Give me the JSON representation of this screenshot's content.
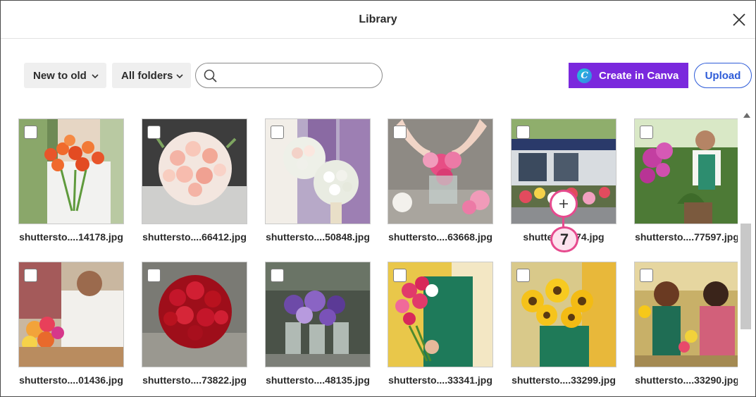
{
  "dialog": {
    "title": "Library"
  },
  "toolbar": {
    "sort_label": "New to old",
    "folder_label": "All folders",
    "search_value": "",
    "search_placeholder": "",
    "create_label": "Create in Canva",
    "create_logo_letter": "C",
    "upload_label": "Upload"
  },
  "colors": {
    "canva_purple": "#7a28dd",
    "upload_blue": "#2d5bd8",
    "callout_pink": "#e64a8e"
  },
  "callout": {
    "step_number": "7",
    "icon": "plus-icon"
  },
  "images": [
    {
      "filename": "shutterst­ o....14178.jpg",
      "scene": "woman holding orange tulips"
    },
    {
      "filename": "shuttersto....66412.jpg",
      "scene": "pink rose bridal bouquet"
    },
    {
      "filename": "shuttersto....50848.jpg",
      "scene": "bridesmaids bouquets"
    },
    {
      "filename": "shuttersto....63668.jpg",
      "scene": "arranging pink flowers in vase"
    },
    {
      "filename": "shutterst...2274.jpg",
      "scene": "flower stall"
    },
    {
      "filename": "shuttersto....77597.jpg",
      "scene": "florist with plants"
    },
    {
      "filename": "shuttersto....01436.jpg",
      "scene": "smiling florist at counter"
    },
    {
      "filename": "shuttersto....73822.jpg",
      "scene": "red roses bouquet"
    },
    {
      "filename": "shuttersto....48135.jpg",
      "scene": "purple flowers in jars"
    },
    {
      "filename": "shuttersto....33341.jpg",
      "scene": "florist holding roses"
    },
    {
      "filename": "shuttersto....33299.jpg",
      "scene": "sunflower bouquet"
    },
    {
      "filename": "shuttersto....33290.jpg",
      "scene": "florist with customer"
    }
  ]
}
